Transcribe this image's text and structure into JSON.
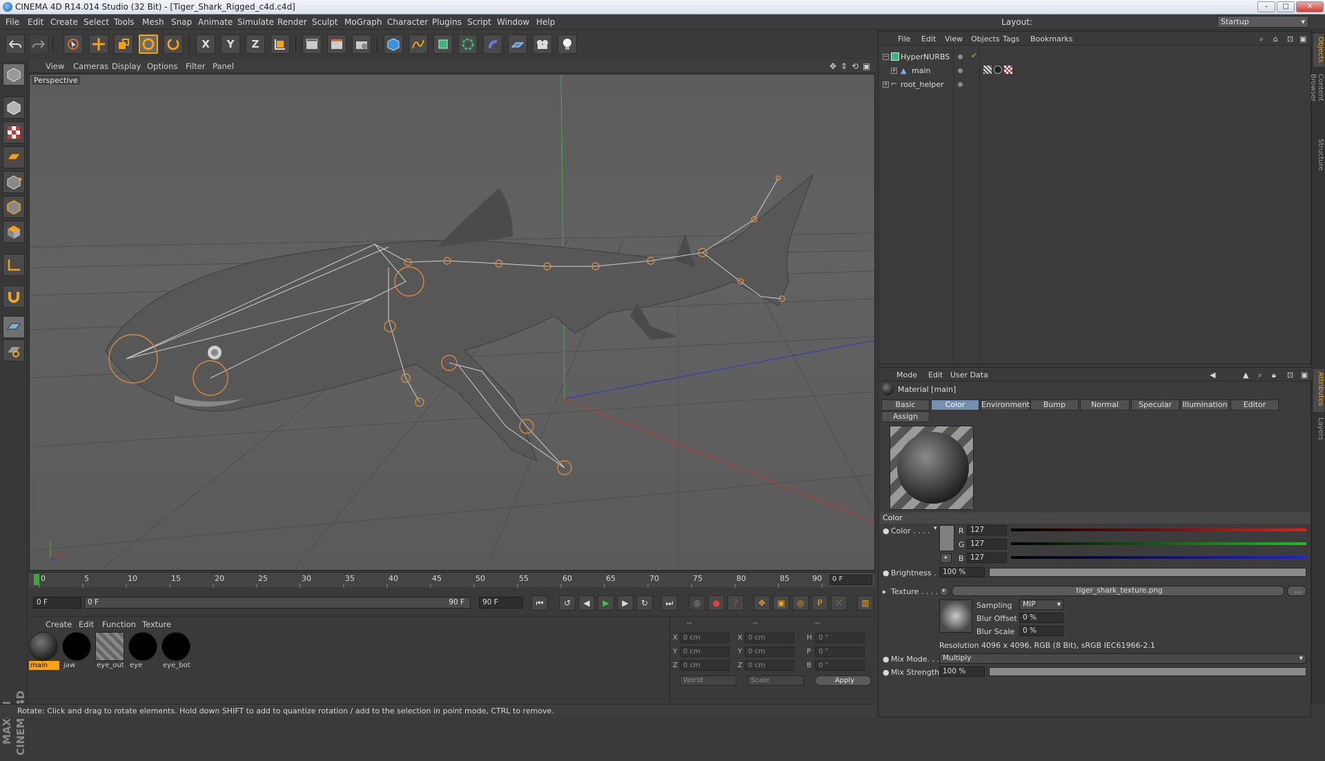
{
  "window": {
    "title": "CINEMA 4D R14.014 Studio (32 Bit) - [Tiger_Shark_Rigged_c4d.c4d]",
    "btn_min": "–",
    "btn_max": "□",
    "btn_close": "✕"
  },
  "menubar": {
    "items": [
      "File",
      "Edit",
      "Create",
      "Select",
      "Tools",
      "Mesh",
      "Snap",
      "Animate",
      "Simulate",
      "Render",
      "Sculpt",
      "MoGraph",
      "Character",
      "Plugins",
      "Script",
      "Window",
      "Help"
    ],
    "layout_label": "Layout:",
    "layout_value": "Startup"
  },
  "toolbar": {
    "x_label": "X",
    "y_label": "Y",
    "z_label": "Z"
  },
  "viewport": {
    "menu": [
      "View",
      "Cameras",
      "Display",
      "Options",
      "Filter",
      "Panel"
    ],
    "label": "Perspective"
  },
  "timeline": {
    "ticks": [
      "0",
      "5",
      "10",
      "15",
      "20",
      "25",
      "30",
      "35",
      "40",
      "45",
      "50",
      "55",
      "60",
      "65",
      "70",
      "75",
      "80",
      "85",
      "90"
    ],
    "current_frame": "0 F",
    "start_field": "0 F",
    "range_start": "0 F",
    "range_end": "90 F",
    "end_field": "90 F"
  },
  "material_manager": {
    "menu": [
      "Create",
      "Edit",
      "Function",
      "Texture"
    ],
    "materials": [
      {
        "name": "main",
        "selected": true
      },
      {
        "name": "jaw",
        "selected": false
      },
      {
        "name": "eye_out",
        "selected": false
      },
      {
        "name": "eye",
        "selected": false
      },
      {
        "name": "eye_bot",
        "selected": false
      }
    ]
  },
  "coordinates": {
    "headers": [
      "--",
      "--",
      "--"
    ],
    "rows": [
      {
        "a": "X",
        "av": "0 cm",
        "b": "X",
        "bv": "0 cm",
        "c": "H",
        "cv": "0 °"
      },
      {
        "a": "Y",
        "av": "0 cm",
        "b": "Y",
        "bv": "0 cm",
        "c": "P",
        "cv": "0 °"
      },
      {
        "a": "Z",
        "av": "0 cm",
        "b": "Z",
        "bv": "0 cm",
        "c": "B",
        "cv": "0 °"
      }
    ],
    "mode1": "World",
    "mode2": "Scale",
    "apply": "Apply"
  },
  "statusbar": {
    "text": "Rotate: Click and drag to rotate elements. Hold down SHIFT to add to quantize rotation / add to the selection in point mode, CTRL to remove."
  },
  "object_manager": {
    "menu": [
      "File",
      "Edit",
      "View",
      "Objects",
      "Tags",
      "Bookmarks"
    ],
    "objects": [
      {
        "name": "HyperNURBS",
        "expander": "−"
      },
      {
        "name": "main",
        "expander": "+"
      },
      {
        "name": "root_helper",
        "expander": "+"
      }
    ]
  },
  "right_tabs": [
    "Objects",
    "Content Browser",
    "Structure",
    "Attributes",
    "Layers"
  ],
  "attributes": {
    "menu": [
      "Mode",
      "Edit",
      "User Data"
    ],
    "header": "Material [main]",
    "tabs": [
      "Basic",
      "Color",
      "Environment",
      "Bump",
      "Normal",
      "Specular",
      "Illumination",
      "Editor",
      "Assign"
    ],
    "active_tab": "Color",
    "section": "Color",
    "color_label": "Color . . . .",
    "r_label": "R",
    "r_value": "127",
    "g_label": "G",
    "g_value": "127",
    "b_label": "B",
    "b_value": "127",
    "brightness_label": "Brightness . .",
    "brightness_value": "100 %",
    "texture_label": "Texture . . . . .",
    "texture_value": "tiger_shark_texture.png",
    "texture_more": "...",
    "sampling_label": "Sampling",
    "sampling_value": "MIP",
    "blur_offset_label": "Blur Offset",
    "blur_offset_value": "0 %",
    "blur_scale_label": "Blur Scale",
    "blur_scale_value": "0 %",
    "resolution": "Resolution 4096 x 4096, RGB (8 Bit), sRGB IEC61966-2.1",
    "mix_mode_label": "Mix Mode. . .",
    "mix_mode_value": "Multiply",
    "mix_strength_label": "Mix Strength",
    "mix_strength_value": "100 %"
  },
  "colors": {
    "accent": "#f2a316",
    "active_tab": "#7390b3",
    "bone": "#d88a3a"
  }
}
